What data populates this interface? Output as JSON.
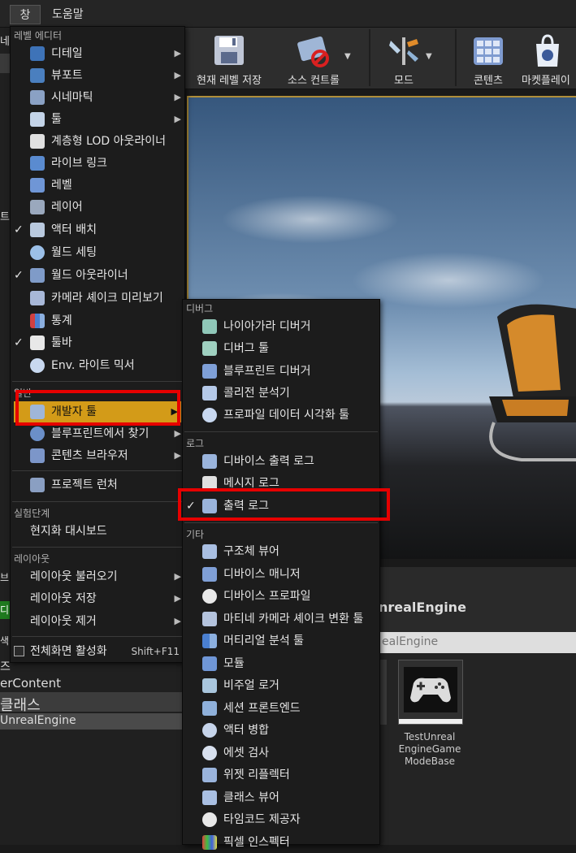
{
  "menubar": {
    "window": "창",
    "help": "도움말"
  },
  "toolbar": [
    {
      "label": "현재 레벨 저장",
      "icon": "save-icon"
    },
    {
      "label": "소스 컨트롤",
      "icon": "source-control-icon"
    },
    {
      "label": "모드",
      "icon": "modes-icon"
    },
    {
      "label": "콘텐츠",
      "icon": "content-icon"
    },
    {
      "label": "마켓플레이",
      "icon": "marketplace-icon"
    }
  ],
  "background_text": {
    "left_fragments": [
      "네",
      "트",
      "브리",
      "디",
      "색",
      "즈",
      "erContent",
      "클래스",
      "UnrealEngine"
    ],
    "path_title": "nrealEngine",
    "path_field": "ealEngine",
    "asset_name": "TestUnreal EngineGame ModeBase"
  },
  "main_menu": {
    "sections": [
      {
        "title": "레벨 에디터",
        "items": [
          {
            "label": "디테일",
            "icon": "details-icon",
            "arrow": true
          },
          {
            "label": "뷰포트",
            "icon": "viewport-icon",
            "arrow": true
          },
          {
            "label": "시네마틱",
            "icon": "cinematic-icon",
            "arrow": true
          },
          {
            "label": "툴",
            "icon": "tools-icon",
            "arrow": true
          },
          {
            "label": "계층형 LOD 아웃라이너",
            "icon": "hlod-icon"
          },
          {
            "label": "라이브 링크",
            "icon": "live-link-icon"
          },
          {
            "label": "레벨",
            "icon": "levels-icon"
          },
          {
            "label": "레이어",
            "icon": "layers-icon"
          },
          {
            "label": "액터 배치",
            "icon": "place-actors-icon",
            "checked": true
          },
          {
            "label": "월드 세팅",
            "icon": "world-settings-icon"
          },
          {
            "label": "월드 아웃라이너",
            "icon": "outliner-icon",
            "checked": true
          },
          {
            "label": "카메라 셰이크 미리보기",
            "icon": "camera-shake-icon"
          },
          {
            "label": "통계",
            "icon": "statistics-icon"
          },
          {
            "label": "툴바",
            "icon": "toolbar-icon",
            "checked": true
          },
          {
            "label": "Env. 라이트 믹서",
            "icon": "env-light-icon"
          }
        ]
      },
      {
        "title": "일반",
        "items": [
          {
            "label": "개발자 툴",
            "icon": "developer-tools-icon",
            "arrow": true,
            "highlighted": true
          },
          {
            "label": "블루프린트에서 찾기",
            "icon": "find-blueprint-icon",
            "arrow": true
          },
          {
            "label": "콘텐츠 브라우저",
            "icon": "content-browser-icon",
            "arrow": true
          }
        ]
      },
      {
        "title": "",
        "items": [
          {
            "label": "프로젝트 런처",
            "icon": "project-launcher-icon"
          }
        ]
      },
      {
        "title": "실험단계",
        "items": [
          {
            "label": "현지화 대시보드",
            "icon": ""
          }
        ]
      },
      {
        "title": "레이아웃",
        "items": [
          {
            "label": "레이아웃 불러오기",
            "arrow": true
          },
          {
            "label": "레이아웃 저장",
            "arrow": true
          },
          {
            "label": "레이아웃 제거",
            "arrow": true
          }
        ]
      }
    ],
    "fullscreen": {
      "label": "전체화면 활성화",
      "shortcut": "Shift+F11"
    }
  },
  "sub_menu": {
    "sections": [
      {
        "title": "디버그",
        "items": [
          {
            "label": "나이아가라 디버거",
            "icon": "niagara-icon"
          },
          {
            "label": "디버그 툴",
            "icon": "debug-tools-icon"
          },
          {
            "label": "블루프린트 디버거",
            "icon": "blueprint-debugger-icon"
          },
          {
            "label": "콜리전 분석기",
            "icon": "collision-icon"
          },
          {
            "label": "프로파일 데이터 시각화 툴",
            "icon": "profiler-icon"
          }
        ]
      },
      {
        "title": "로그",
        "items": [
          {
            "label": "디바이스 출력 로그",
            "icon": "device-log-icon"
          },
          {
            "label": "메시지 로그",
            "icon": "message-log-icon"
          },
          {
            "label": "출력 로그",
            "icon": "output-log-icon",
            "checked": true
          }
        ]
      },
      {
        "title": "기타",
        "items": [
          {
            "label": "구조체 뷰어",
            "icon": "struct-viewer-icon"
          },
          {
            "label": "디바이스 매니저",
            "icon": "device-manager-icon"
          },
          {
            "label": "디바이스 프로파일",
            "icon": "device-profile-icon"
          },
          {
            "label": "마티네 카메라 셰이크 변환 툴",
            "icon": "matinee-icon"
          },
          {
            "label": "머티리얼 분석 툴",
            "icon": "material-analyzer-icon"
          },
          {
            "label": "모듈",
            "icon": "modules-icon"
          },
          {
            "label": "비주얼 로거",
            "icon": "visual-logger-icon"
          },
          {
            "label": "세션 프론트엔드",
            "icon": "session-frontend-icon"
          },
          {
            "label": "액터 병합",
            "icon": "merge-actors-icon"
          },
          {
            "label": "에셋 검사",
            "icon": "asset-audit-icon"
          },
          {
            "label": "위젯 리플렉터",
            "icon": "widget-reflector-icon"
          },
          {
            "label": "클래스 뷰어",
            "icon": "class-viewer-icon"
          },
          {
            "label": "타임코드 제공자",
            "icon": "timecode-icon"
          },
          {
            "label": "픽셀 인스펙터",
            "icon": "pixel-inspector-icon"
          }
        ]
      }
    ]
  },
  "colors": {
    "highlight": "#d39b18",
    "annotation": "#e60000",
    "menu_bg": "#1c1c1c"
  }
}
